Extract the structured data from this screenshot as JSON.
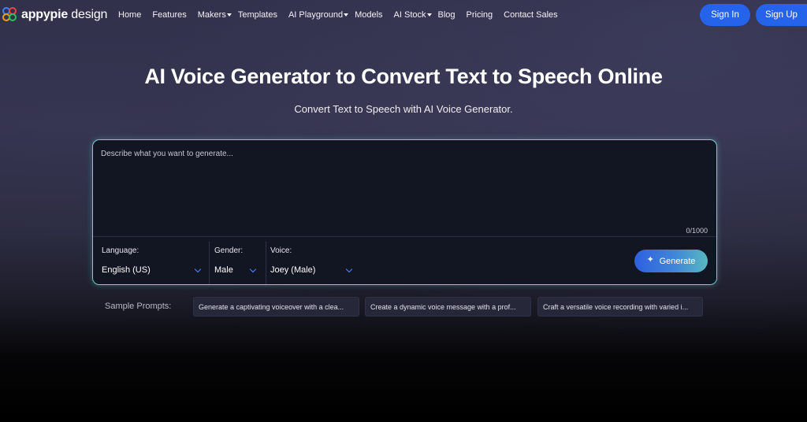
{
  "brand": {
    "name_bold": "appypie",
    "name_light": " design"
  },
  "nav": {
    "links": [
      {
        "label": "Home",
        "has_dropdown": false
      },
      {
        "label": "Features",
        "has_dropdown": false
      },
      {
        "label": "Makers",
        "has_dropdown": true
      },
      {
        "label": "Templates",
        "has_dropdown": false
      },
      {
        "label": "AI Playground",
        "has_dropdown": true
      },
      {
        "label": "Models",
        "has_dropdown": false
      },
      {
        "label": "AI Stock",
        "has_dropdown": true
      },
      {
        "label": "Blog",
        "has_dropdown": false
      },
      {
        "label": "Pricing",
        "has_dropdown": false
      },
      {
        "label": "Contact Sales",
        "has_dropdown": false
      }
    ],
    "sign_in": "Sign In",
    "sign_up": "Sign Up"
  },
  "hero": {
    "title": "AI Voice Generator to Convert Text to Speech Online",
    "subtitle": "Convert Text to Speech with AI Voice Generator."
  },
  "prompt": {
    "placeholder": "Describe what you want to generate...",
    "value": "",
    "char_count": "0/1000"
  },
  "controls": {
    "language": {
      "label": "Language:",
      "value": "English (US)"
    },
    "gender": {
      "label": "Gender:",
      "value": "Male"
    },
    "voice": {
      "label": "Voice:",
      "value": "Joey (Male)"
    },
    "generate": "Generate"
  },
  "samples": {
    "label": "Sample Prompts:",
    "items": [
      "Generate a captivating voiceover with a clea...",
      "Create a dynamic voice message with a prof...",
      "Craft a versatile voice recording with varied i..."
    ]
  },
  "colors": {
    "accent": "#2563eb",
    "prompt_border": "#6fd3cf",
    "generate_gradient_start": "#2f5fe0",
    "generate_gradient_end": "#58b8c0"
  }
}
